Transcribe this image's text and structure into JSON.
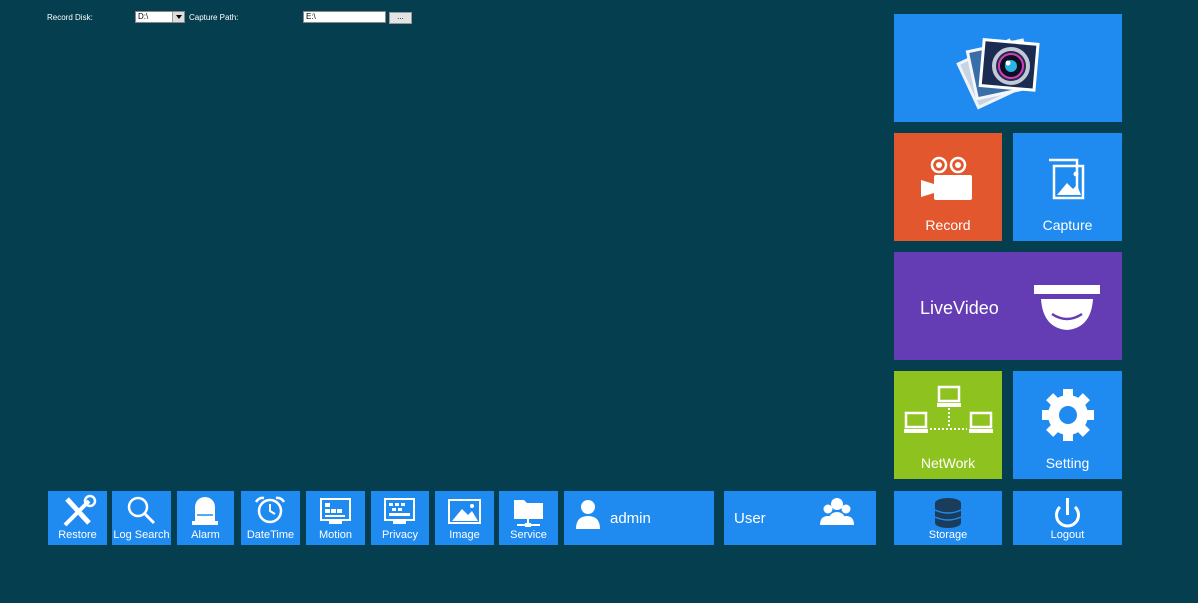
{
  "topbar": {
    "record_disk_label": "Record Disk:",
    "record_disk_value": "D:\\",
    "capture_path_label": "Capture Path:",
    "capture_path_value": "E:\\",
    "browse_label": "..."
  },
  "tiles": {
    "record": "Record",
    "capture": "Capture",
    "livevideo": "LiveVideo",
    "network": "NetWork",
    "setting": "Setting",
    "storage": "Storage",
    "logout": "Logout",
    "admin": "admin",
    "user": "User"
  },
  "bottombar": {
    "restore": "Restore",
    "log_search": "Log Search",
    "alarm": "Alarm",
    "datetime": "DateTime",
    "motion": "Motion",
    "privacy": "Privacy",
    "image": "Image",
    "service": "Service"
  },
  "colors": {
    "background": "#053f4f",
    "blue": "#1f8af0",
    "orange": "#e2572d",
    "purple": "#643db5",
    "green": "#8dc21f"
  }
}
